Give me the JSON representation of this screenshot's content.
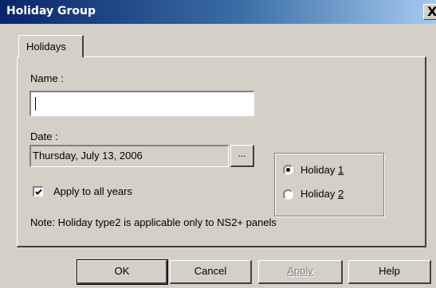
{
  "window": {
    "title": "Holiday Group",
    "close_glyph": "X"
  },
  "tabs": [
    {
      "label": "Holidays"
    }
  ],
  "form": {
    "name_label": "Name :",
    "name_value": "",
    "date_label": "Date :",
    "date_value": "Thursday, July 13, 2006",
    "date_button_label": "...",
    "apply_all_years_label": "Apply to all years",
    "apply_all_years_checked": true,
    "holiday_type": {
      "options": [
        {
          "text": "Holiday ",
          "mnemonic": "1",
          "selected": true
        },
        {
          "text": "Holiday ",
          "mnemonic": "2",
          "selected": false
        }
      ]
    },
    "note": "Note: Holiday type2 is applicable only to NS2+ panels"
  },
  "buttons": {
    "ok": "OK",
    "cancel": "Cancel",
    "apply": "Apply",
    "help": "Help"
  },
  "icons": {
    "check": "check-icon",
    "radio_dot": "radio-dot-icon"
  }
}
